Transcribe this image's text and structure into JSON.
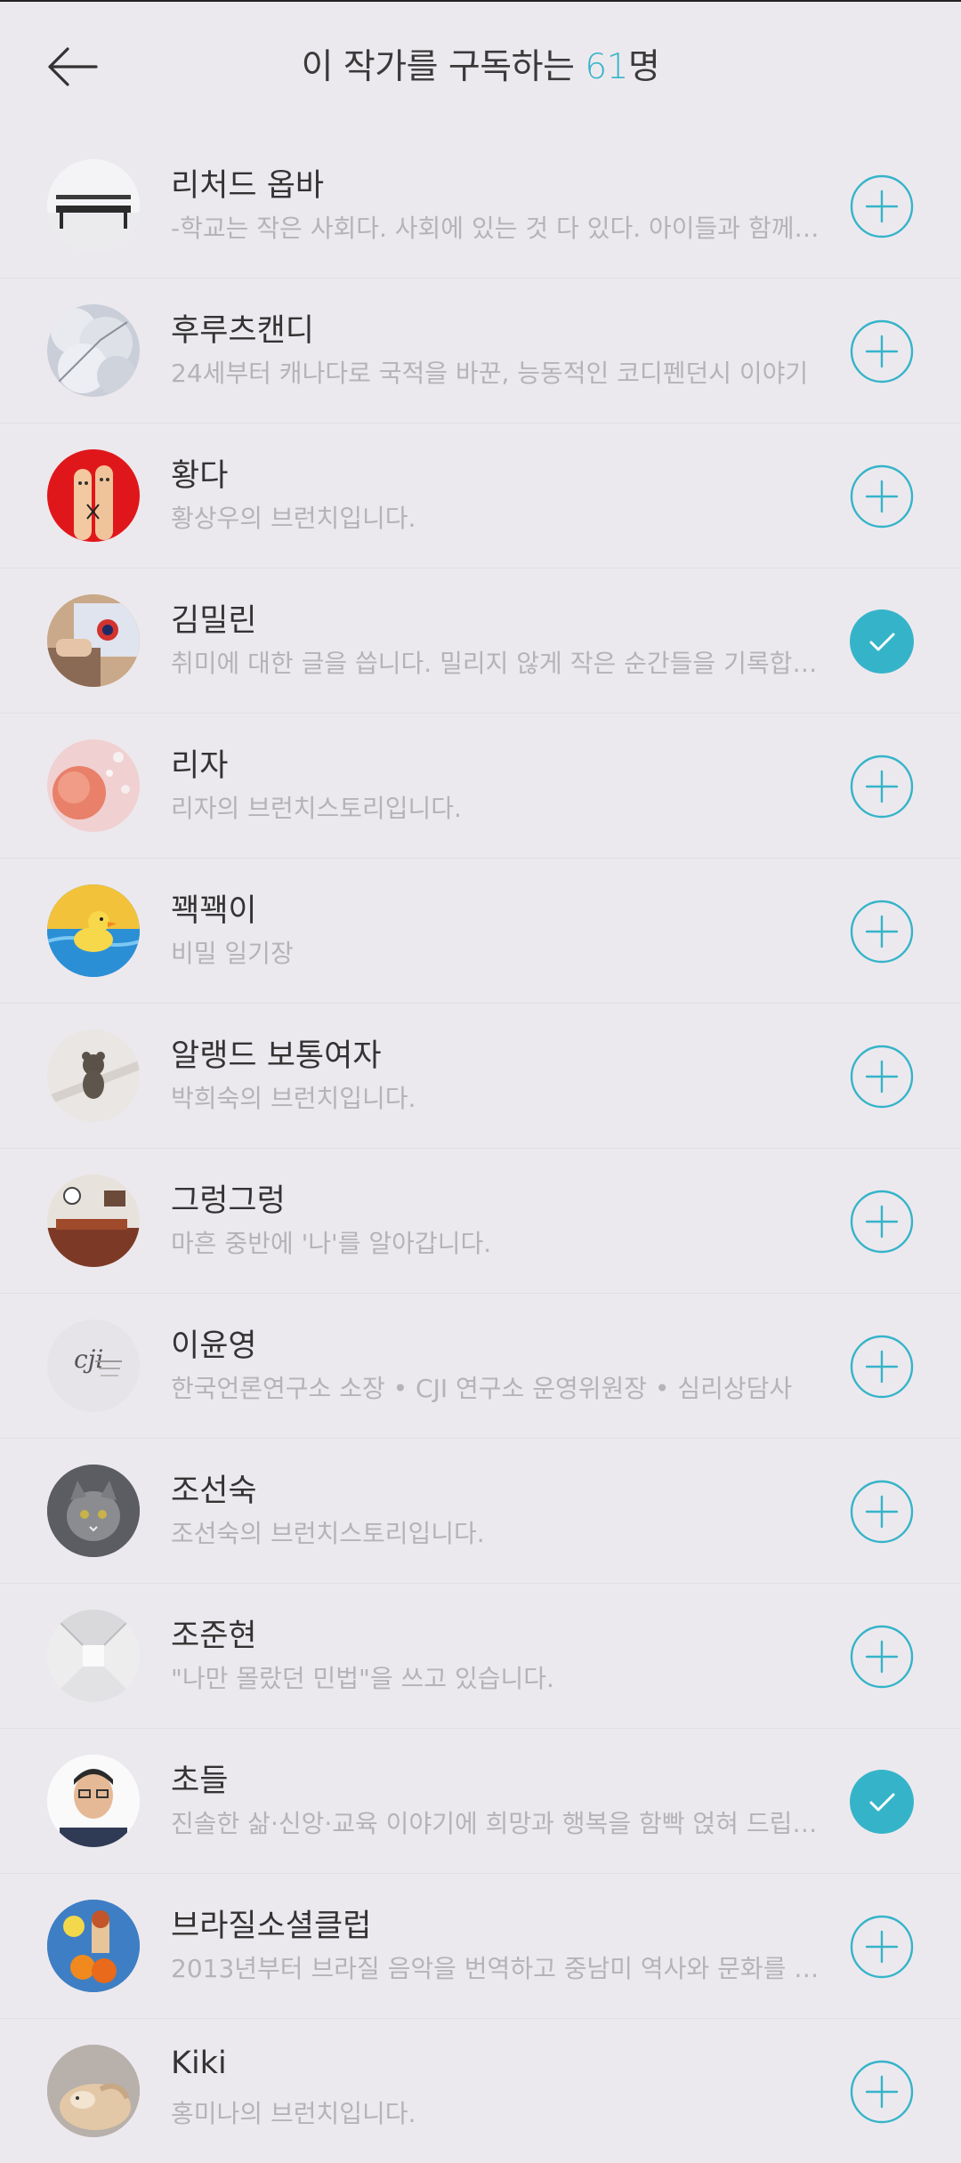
{
  "header": {
    "title_prefix": "이 작가를 구독하는 ",
    "count": "61",
    "title_suffix": "명"
  },
  "colors": {
    "accent": "#35b4c9",
    "background": "#ece9ee",
    "description": "#b5b2b8"
  },
  "writers": [
    {
      "name": "리처드 옵바",
      "description": "-학교는 작은 사회다. 사회에 있는 것 다 있다. 아이들과 함께하는 이야기",
      "subscribed": false,
      "avatar_icon": "bench-photo"
    },
    {
      "name": "후루츠캔디",
      "description": "24세부터 캐나다로 국적을 바꾼, 능동적인 코디펜던시 이야기",
      "subscribed": false,
      "avatar_icon": "white-blossom-photo"
    },
    {
      "name": "황다",
      "description": "황상우의 브런치입니다.",
      "subscribed": false,
      "avatar_icon": "finger-couple-photo"
    },
    {
      "name": "김밀린",
      "description": "취미에 대한 글을 씁니다. 밀리지 않게 작은 순간들을 기록합니다",
      "subscribed": true,
      "avatar_icon": "drawing-tablet-photo"
    },
    {
      "name": "리자",
      "description": "리자의 브런치스토리입니다.",
      "subscribed": false,
      "avatar_icon": "pink-flower-photo"
    },
    {
      "name": "꽥꽥이",
      "description": "비밀 일기장",
      "subscribed": false,
      "avatar_icon": "duck-photo"
    },
    {
      "name": "알랭드 보통여자",
      "description": "박희숙의 브런치입니다.",
      "subscribed": false,
      "avatar_icon": "teddy-bear-photo"
    },
    {
      "name": "그렁그렁",
      "description": "마흔 중반에 '나'를 알아갑니다.",
      "subscribed": false,
      "avatar_icon": "interior-photo"
    },
    {
      "name": "이윤영",
      "description": "한국언론연구소 소장 • CJI 연구소 운영위원장 • 심리상담사",
      "subscribed": false,
      "avatar_icon": "cji-logo"
    },
    {
      "name": "조선숙",
      "description": "조선숙의 브런치스토리입니다.",
      "subscribed": false,
      "avatar_icon": "cat-photo"
    },
    {
      "name": "조준현",
      "description": "\"나만 몰랐던 민법\"을 쓰고 있습니다.",
      "subscribed": false,
      "avatar_icon": "corridor-photo"
    },
    {
      "name": "초들",
      "description": "진솔한 삶·신앙·교육 이야기에 희망과 행복을 함빡 얹혀 드립니다",
      "subscribed": true,
      "avatar_icon": "man-portrait-photo"
    },
    {
      "name": "브라질소셜클럽",
      "description": "2013년부터 브라질 음악을 번역하고 중남미 역사와 문화를 소개합니다",
      "subscribed": false,
      "avatar_icon": "painting-photo"
    },
    {
      "name": "Kiki",
      "description": "홍미나의 브런치입니다.",
      "subscribed": false,
      "avatar_icon": "dog-photo"
    }
  ]
}
